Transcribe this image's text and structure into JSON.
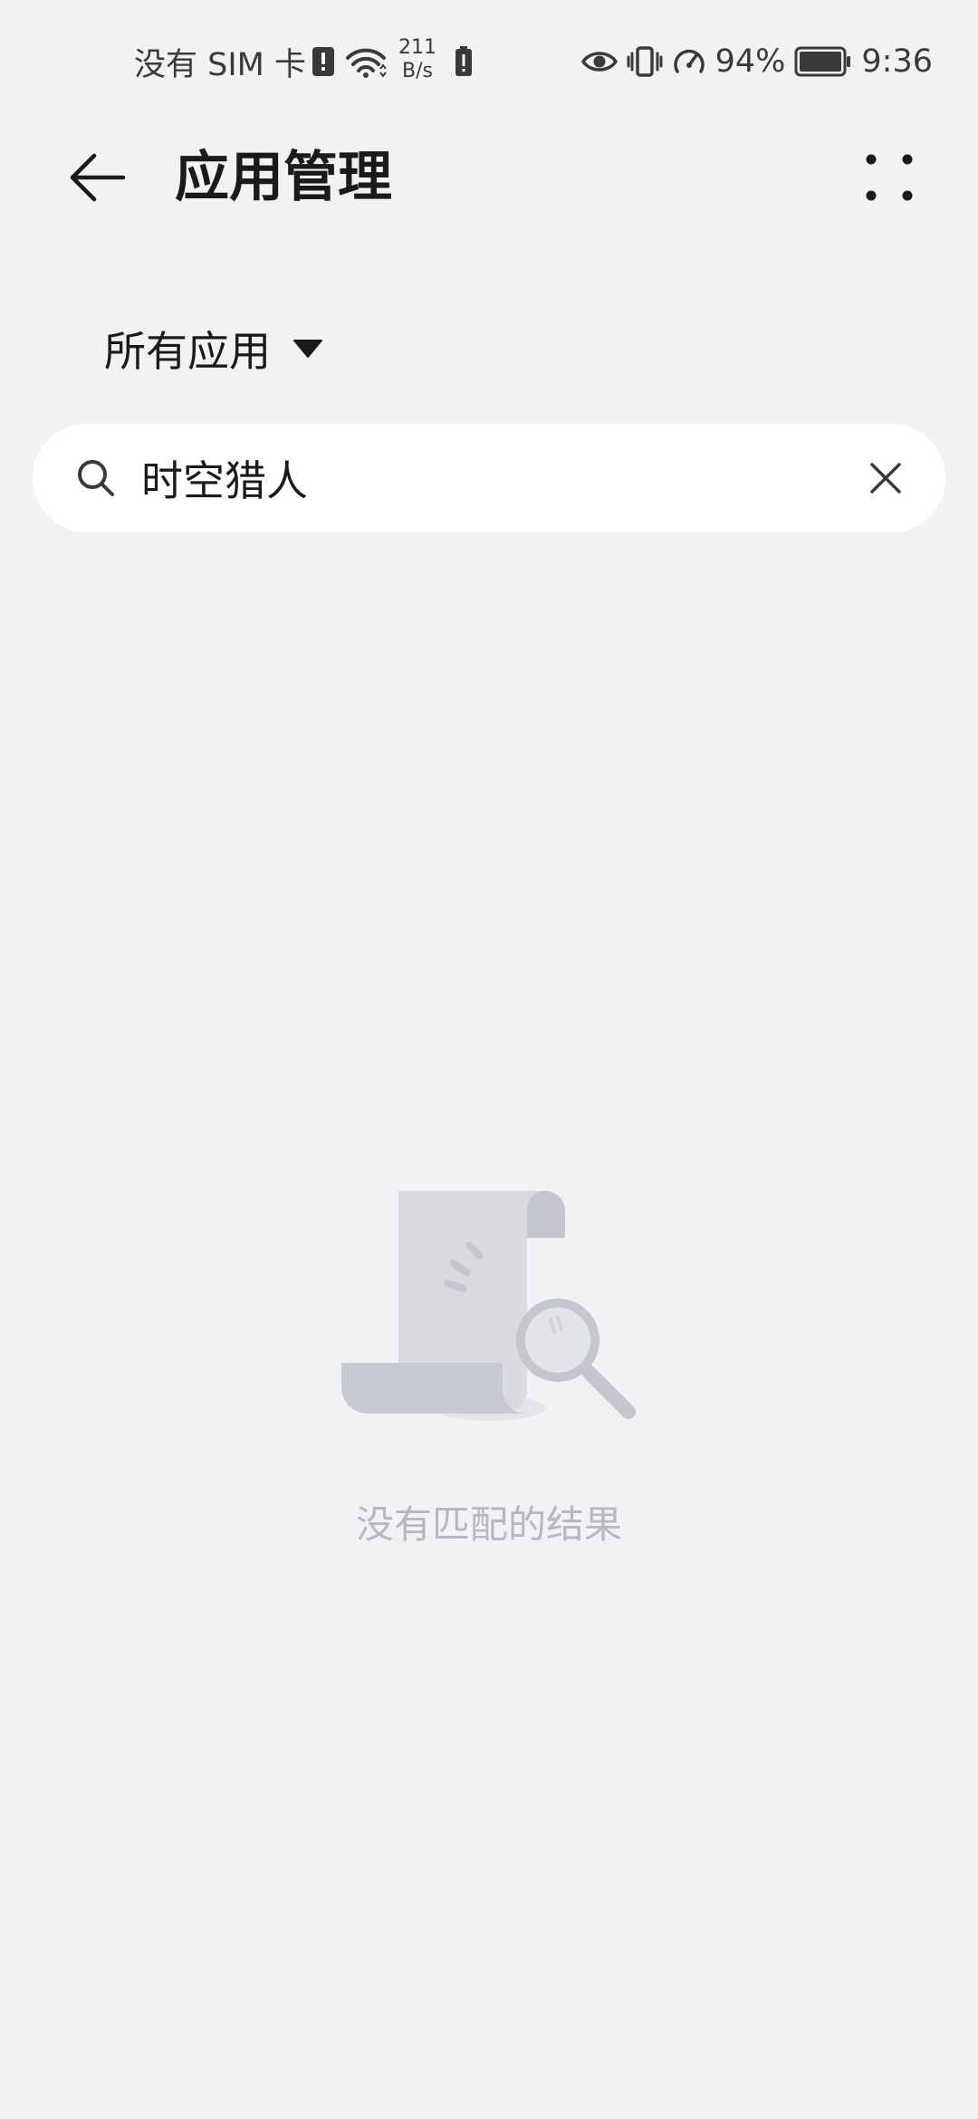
{
  "status_bar": {
    "carrier": "没有 SIM 卡",
    "net_speed_value": "211",
    "net_speed_unit": "B/s",
    "battery_percent": "94%",
    "time": "9:36",
    "icons": [
      "sim-alert-icon",
      "wifi-icon",
      "battery-alert-icon",
      "eye-icon",
      "vibrate-icon",
      "speed-icon",
      "battery-icon"
    ]
  },
  "app_bar": {
    "title": "应用管理",
    "back_icon": "arrow-left-icon",
    "more_icon": "more-dots-icon"
  },
  "filter": {
    "label": "所有应用",
    "caret_icon": "caret-down-icon"
  },
  "search": {
    "value": "时空猎人",
    "search_icon": "search-icon",
    "clear_icon": "close-icon"
  },
  "empty_state": {
    "message": "没有匹配的结果",
    "illustration": "no-results-illustration"
  },
  "colors": {
    "background": "#f1f2f4",
    "surface": "#ffffff",
    "text_primary": "#1a1a1a",
    "text_hint": "#b6b8bd",
    "illustration": "#d9dbe0"
  }
}
